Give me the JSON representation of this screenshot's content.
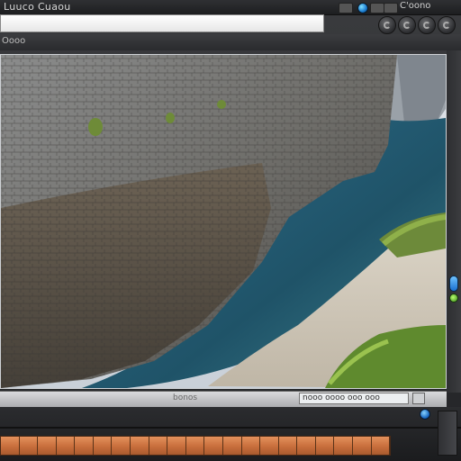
{
  "window": {
    "title": "Luuco Cuaou",
    "top_right_label": "C'oono",
    "subtitle": "Oooo",
    "accent": "#1a7bd0"
  },
  "address": {
    "value": ""
  },
  "status": {
    "center_text": "bonos",
    "right_text": "nooo oooo ooo ooo"
  },
  "icons": {
    "led": "status-led-icon",
    "refresh": "refresh-icon",
    "side_toggle": "toggle-icon"
  },
  "timeline": {
    "frame_count": 21
  }
}
